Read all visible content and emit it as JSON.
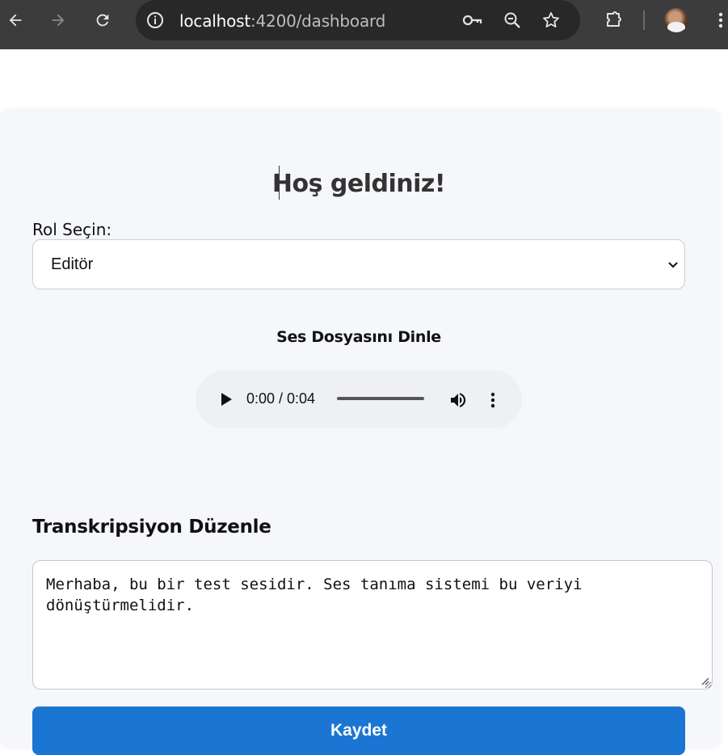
{
  "browser": {
    "url_host": "localhost",
    "url_rest": ":4200/dashboard",
    "icons": {
      "back": "back-arrow-icon",
      "forward": "forward-arrow-icon",
      "reload": "reload-icon",
      "site_info": "site-info-icon",
      "password": "key-icon",
      "zoom": "zoom-icon",
      "bookmark": "star-icon",
      "extensions": "puzzle-icon",
      "menu": "kebab-menu-icon"
    }
  },
  "page": {
    "title": "Hoş geldiniz!",
    "role": {
      "label": "Rol Seçin:",
      "selected": "Editör"
    },
    "audio": {
      "heading": "Ses Dosyasını Dinle",
      "time": "0:00 / 0:04"
    },
    "transcription": {
      "heading": "Transkripsiyon Düzenle",
      "text": "Merhaba, bu bir test sesidir. Ses tanıma sistemi bu veriyi\ndönüştürmelidir."
    },
    "save_label": "Kaydet",
    "colors": {
      "accent": "#1a76d2",
      "card_bg": "#f5f7fb"
    }
  }
}
